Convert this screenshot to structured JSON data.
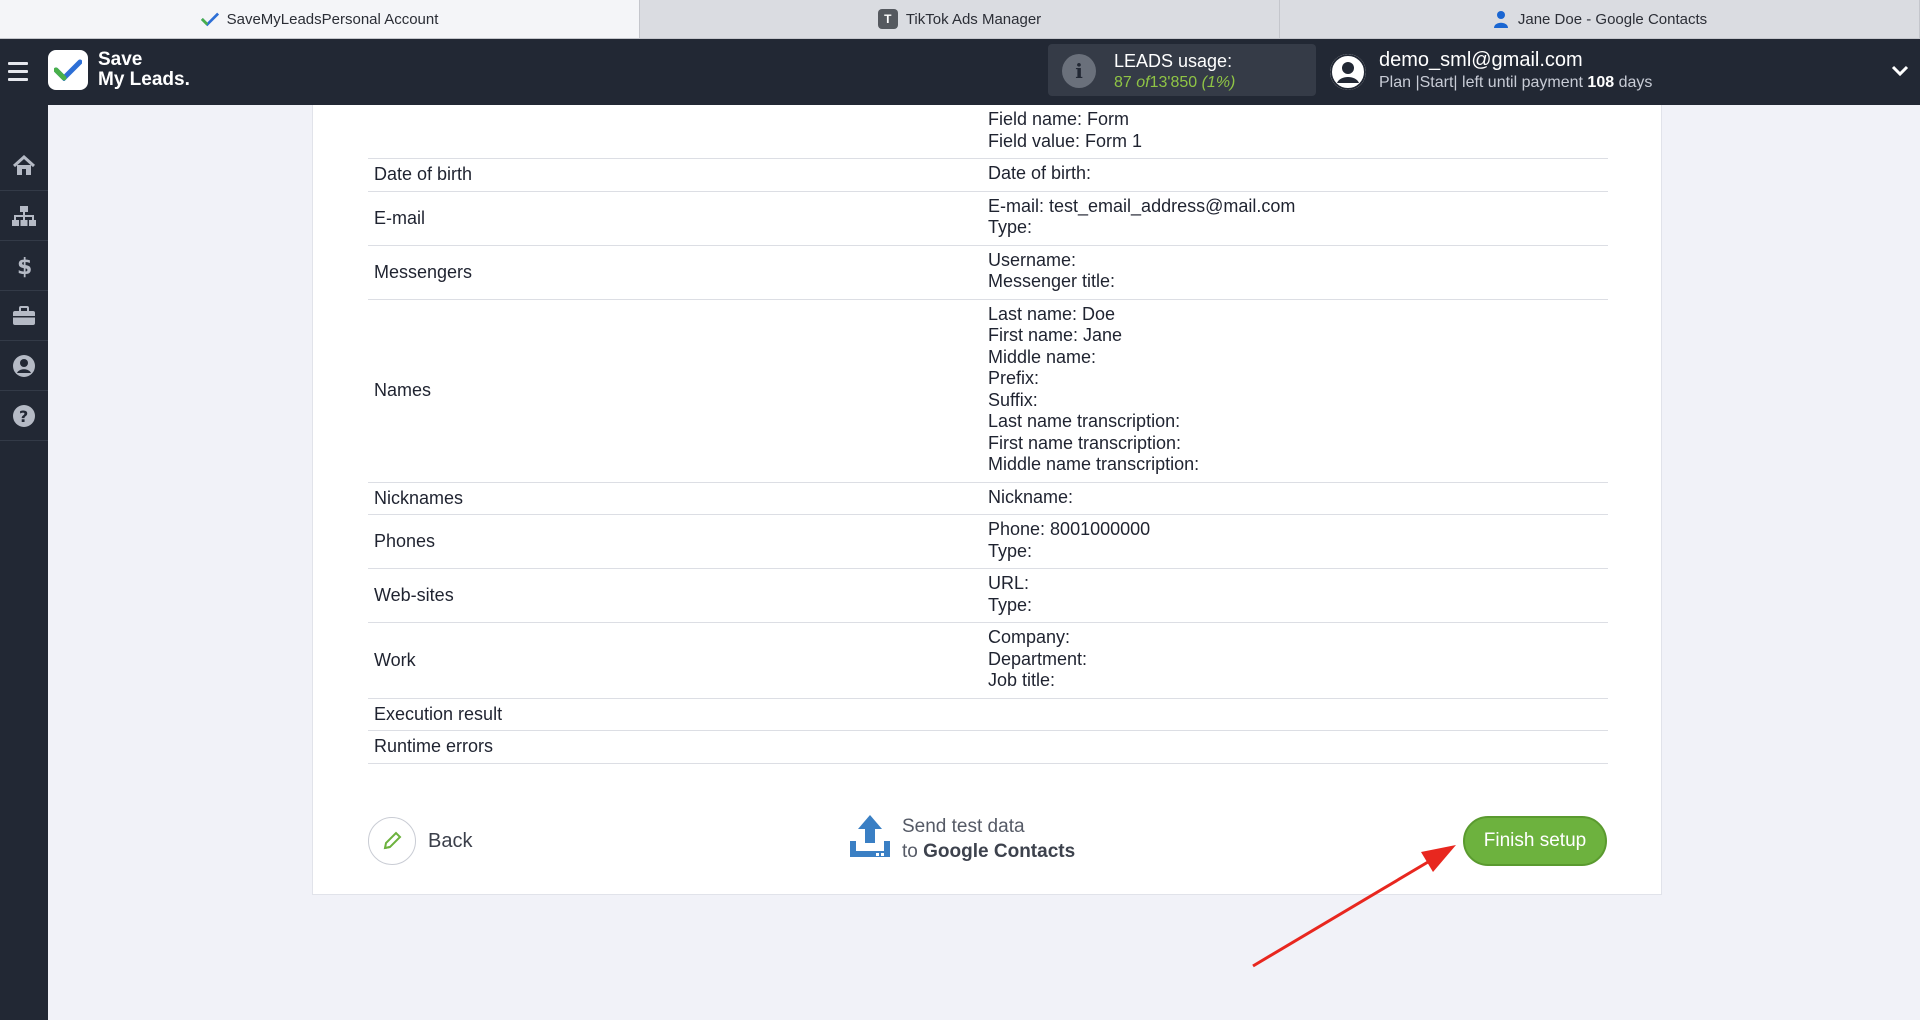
{
  "browser_tabs": [
    {
      "label": "SaveMyLeadsPersonal Account",
      "icon": "checkmark-icon",
      "active": true
    },
    {
      "label": "TikTok Ads Manager",
      "icon": "t-letter-icon",
      "active": false
    },
    {
      "label": "Jane Doe - Google Contacts",
      "icon": "person-icon",
      "active": false
    }
  ],
  "header": {
    "logo_line1": "Save",
    "logo_line2": "My Leads.",
    "usage_title": "LEADS usage:",
    "usage_count": "87",
    "usage_of": "of",
    "usage_limit": "13'850",
    "usage_percent": "(1%)",
    "account_email": "demo_sml@gmail.com",
    "plan_text": "Plan |Start| left until payment",
    "plan_days_number": "108",
    "plan_days_unit": "days"
  },
  "sidebar": {
    "icons": [
      "home-icon",
      "sitemap-icon",
      "dollar-icon",
      "briefcase-icon",
      "user-circle-icon",
      "help-icon"
    ]
  },
  "table": {
    "rows": [
      {
        "name": "",
        "values": [
          "Field name: Form",
          "Field value: Form 1"
        ]
      },
      {
        "name": "Date of birth",
        "values": [
          "Date of birth:"
        ]
      },
      {
        "name": "E-mail",
        "values": [
          "E-mail: test_email_address@mail.com",
          "Type:"
        ]
      },
      {
        "name": "Messengers",
        "values": [
          "Username:",
          "Messenger title:"
        ]
      },
      {
        "name": "Names",
        "values": [
          "Last name: Doe",
          "First name: Jane",
          "Middle name:",
          "Prefix:",
          "Suffix:",
          "Last name transcription:",
          "First name transcription:",
          "Middle name transcription:"
        ]
      },
      {
        "name": "Nicknames",
        "values": [
          "Nickname:"
        ]
      },
      {
        "name": "Phones",
        "values": [
          "Phone: 8001000000",
          "Type:"
        ]
      },
      {
        "name": "Web-sites",
        "values": [
          "URL:",
          "Type:"
        ]
      },
      {
        "name": "Work",
        "values": [
          "Company:",
          "Department:",
          "Job title:"
        ]
      },
      {
        "name": "Execution result",
        "values": [
          ""
        ]
      },
      {
        "name": "Runtime errors",
        "values": [
          ""
        ]
      }
    ]
  },
  "actions": {
    "back_label": "Back",
    "send_line1": "Send test data",
    "send_line2_prefix": "to",
    "send_line2_target": "Google Contacts",
    "finish_label": "Finish setup"
  },
  "colors": {
    "accent_green": "#6db23e",
    "topbar_bg": "#222834",
    "usage_green": "#8fc445",
    "annotation_arrow": "#e8271f"
  }
}
